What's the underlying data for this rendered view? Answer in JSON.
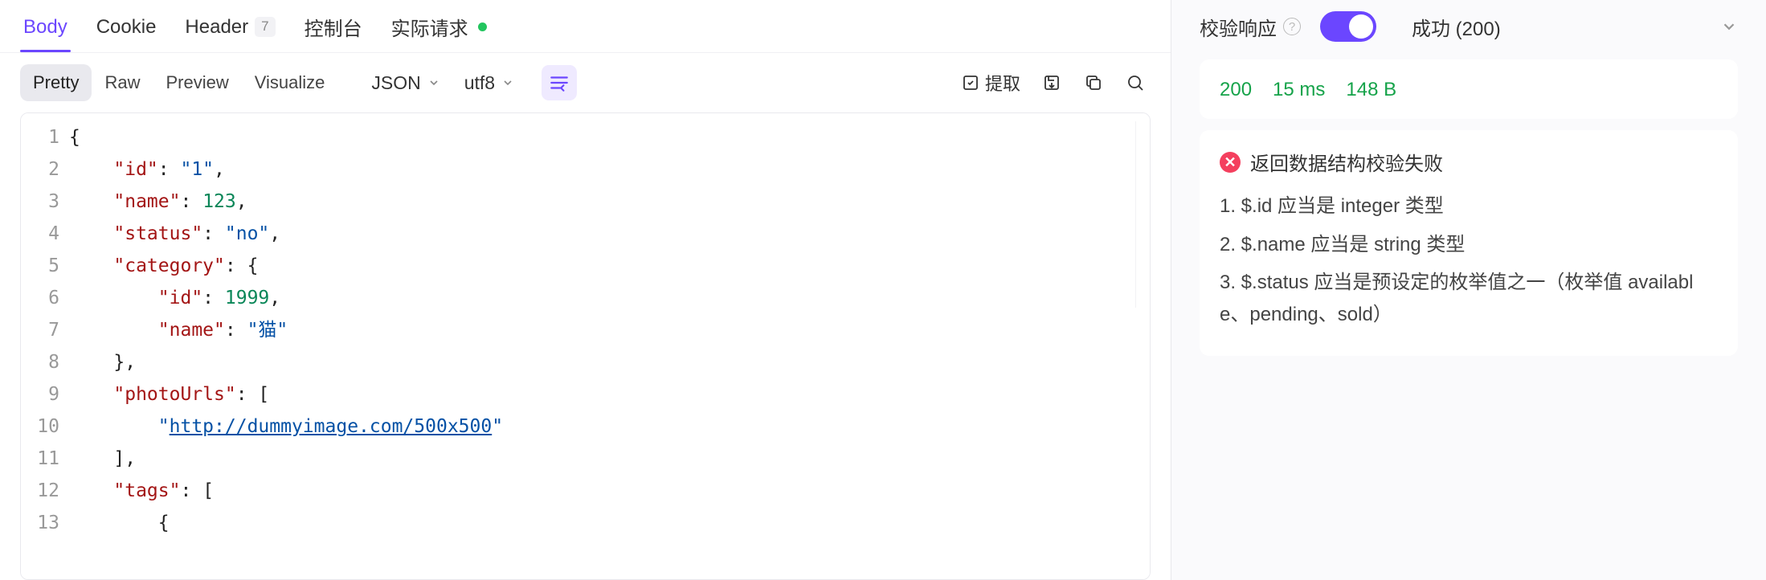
{
  "tabs": {
    "body": "Body",
    "cookie": "Cookie",
    "header": "Header",
    "header_count": "7",
    "console": "控制台",
    "actual_request": "实际请求"
  },
  "view_modes": {
    "pretty": "Pretty",
    "raw": "Raw",
    "preview": "Preview",
    "visualize": "Visualize"
  },
  "format_dd": "JSON",
  "encoding_dd": "utf8",
  "extract_label": "提取",
  "code": {
    "lines": [
      {
        "n": "1",
        "indent": 0,
        "type": "open",
        "tokens": [
          {
            "t": "pun",
            "v": "{"
          }
        ]
      },
      {
        "n": "2",
        "indent": 1,
        "type": "kv",
        "key": "\"id\"",
        "sep": ": ",
        "val": "\"1\"",
        "valType": "str",
        "trail": ","
      },
      {
        "n": "3",
        "indent": 1,
        "type": "kv",
        "key": "\"name\"",
        "sep": ": ",
        "val": "123",
        "valType": "num",
        "trail": ","
      },
      {
        "n": "4",
        "indent": 1,
        "type": "kv",
        "key": "\"status\"",
        "sep": ": ",
        "val": "\"no\"",
        "valType": "str",
        "trail": ","
      },
      {
        "n": "5",
        "indent": 1,
        "type": "kv",
        "key": "\"category\"",
        "sep": ": ",
        "val": "{",
        "valType": "pun",
        "trail": ""
      },
      {
        "n": "6",
        "indent": 2,
        "type": "kv",
        "key": "\"id\"",
        "sep": ": ",
        "val": "1999",
        "valType": "num",
        "trail": ","
      },
      {
        "n": "7",
        "indent": 2,
        "type": "kv",
        "key": "\"name\"",
        "sep": ": ",
        "val": "\"猫\"",
        "valType": "str",
        "trail": ""
      },
      {
        "n": "8",
        "indent": 1,
        "type": "raw",
        "tokens": [
          {
            "t": "pun",
            "v": "},"
          }
        ]
      },
      {
        "n": "9",
        "indent": 1,
        "type": "kv",
        "key": "\"photoUrls\"",
        "sep": ": ",
        "val": "[",
        "valType": "pun",
        "trail": ""
      },
      {
        "n": "10",
        "indent": 2,
        "type": "val",
        "pre": "\"",
        "val": "http://dummyimage.com/500x500",
        "post": "\"",
        "valType": "url",
        "trail": ""
      },
      {
        "n": "11",
        "indent": 1,
        "type": "raw",
        "tokens": [
          {
            "t": "pun",
            "v": "],"
          }
        ]
      },
      {
        "n": "12",
        "indent": 1,
        "type": "kv",
        "key": "\"tags\"",
        "sep": ": ",
        "val": "[",
        "valType": "pun",
        "trail": ""
      },
      {
        "n": "13",
        "indent": 2,
        "type": "raw",
        "tokens": [
          {
            "t": "pun",
            "v": "{"
          }
        ]
      }
    ]
  },
  "right": {
    "validate_label": "校验响应",
    "status_text": "成功 (200)",
    "metrics": {
      "status": "200",
      "time": "15 ms",
      "size": "148 B"
    },
    "card_title": "返回数据结构校验失败",
    "errors": [
      "1. $.id 应当是 integer 类型",
      "2. $.name 应当是 string 类型",
      "3. $.status 应当是预设定的枚举值之一（枚举值 available、pending、sold）"
    ]
  }
}
